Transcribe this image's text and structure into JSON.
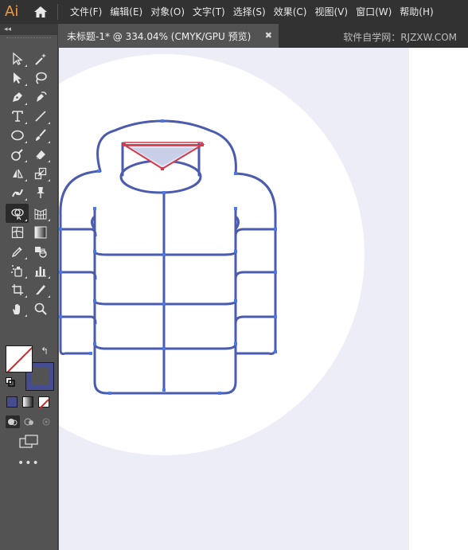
{
  "app": {
    "logo": "Ai"
  },
  "menu": {
    "items": [
      "文件(F)",
      "编辑(E)",
      "对象(O)",
      "文字(T)",
      "选择(S)",
      "效果(C)",
      "视图(V)",
      "窗口(W)",
      "帮助(H)"
    ]
  },
  "toolbar": {
    "collapse_label": "◂◂"
  },
  "document": {
    "tab_title": "未标题-1* @ 334.04% (CMYK/GPU 预览)",
    "close_label": "✖",
    "watermark": "软件自学网：RJZXW.COM"
  },
  "more_label": "•••",
  "colors": {
    "menubar": "#323232",
    "panel": "#535353",
    "artboard_bg": "#ededf8",
    "circle": "#ffffff",
    "stroke": "#4a5bb0",
    "anchor": "#4a78e6",
    "selection": "#d43a4a",
    "stroke_swatch": "#464c90",
    "logo": "#f29a3d"
  },
  "icons": {
    "tools": [
      [
        "selection-tool-icon",
        "direct-selection-tool-icon"
      ],
      [
        "pen-tool-icon",
        "curvature-tool-icon"
      ],
      [
        "type-tool-icon",
        "line-segment-tool-icon"
      ],
      [
        "ellipse-tool-icon",
        "paintbrush-tool-icon"
      ],
      [
        "shaper-tool-icon",
        "eraser-tool-icon"
      ],
      [
        "reflect-tool-icon",
        "scale-tool-icon"
      ],
      [
        "puppet-warp-tool-icon",
        "pin-icon"
      ],
      [
        "shape-builder-tool-icon",
        "perspective-grid-tool-icon"
      ],
      [
        "mesh-tool-icon",
        "gradient-tool-icon"
      ],
      [
        "eyedropper-tool-icon",
        "blend-tool-icon"
      ],
      [
        "symbol-sprayer-tool-icon",
        "column-graph-tool-icon"
      ],
      [
        "artboard-tool-icon",
        "slice-tool-icon"
      ],
      [
        "hand-tool-icon",
        "zoom-tool-icon"
      ]
    ]
  }
}
